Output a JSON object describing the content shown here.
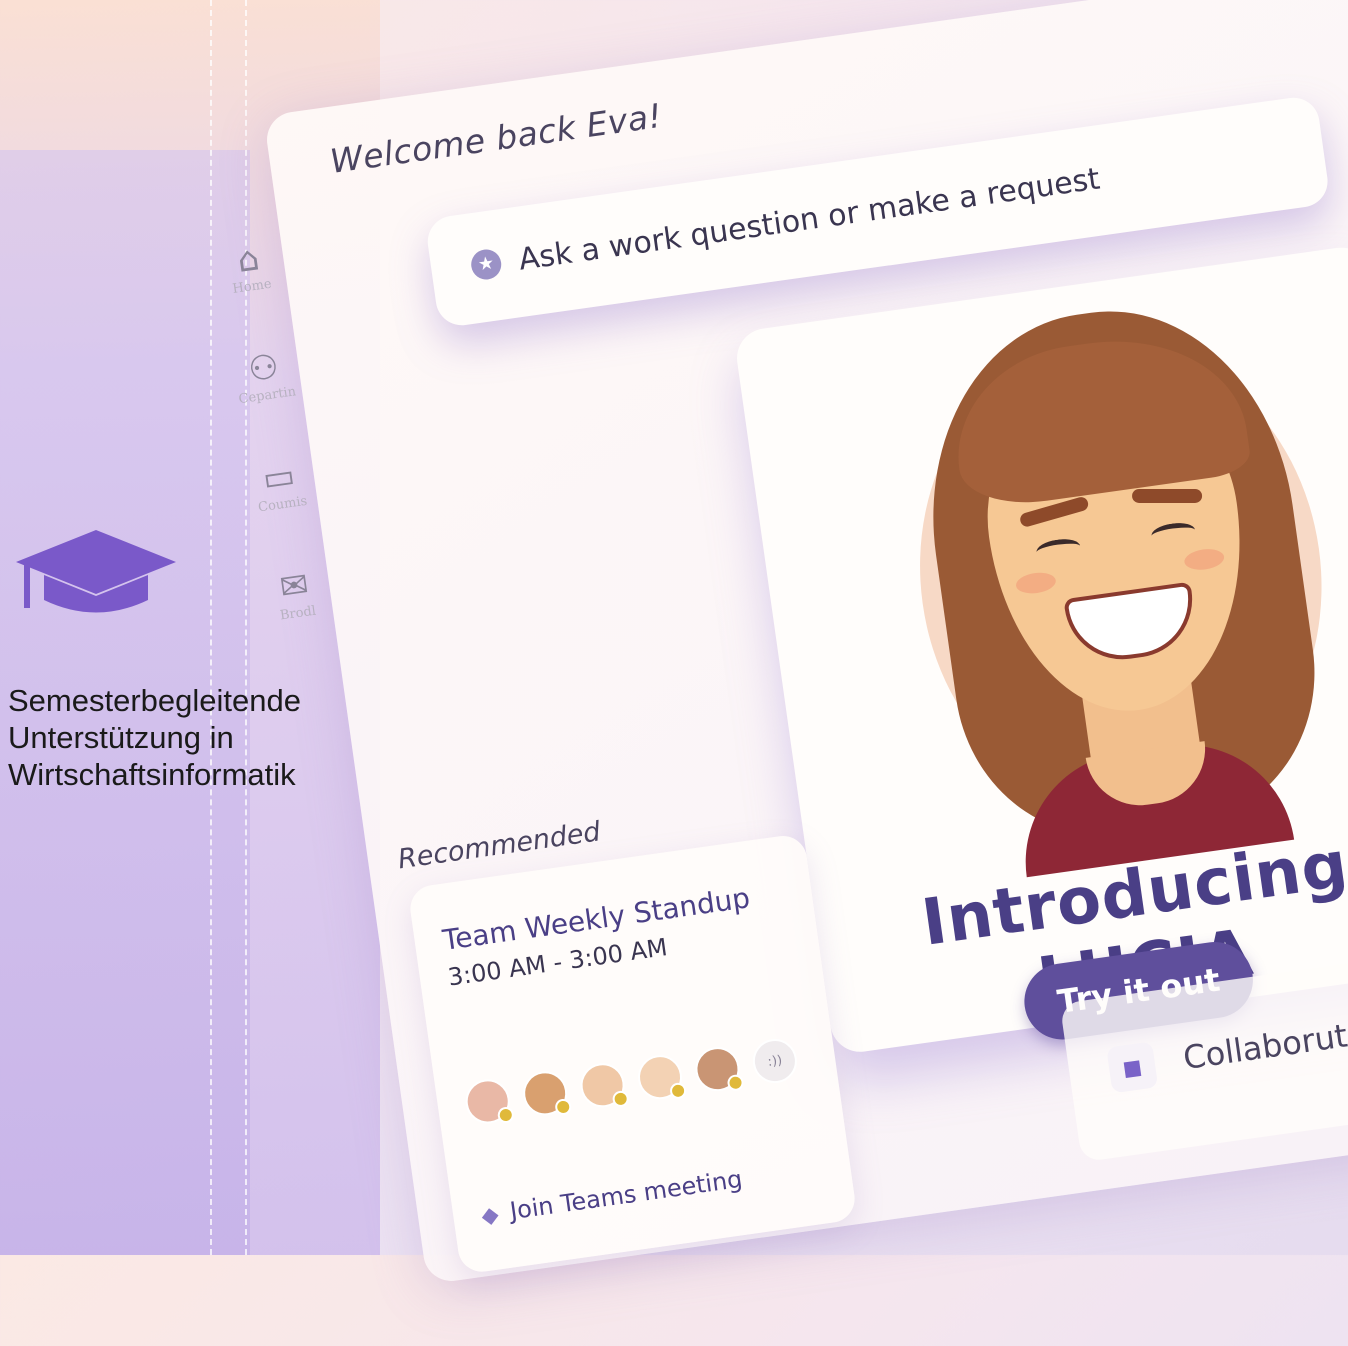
{
  "welcome": "Welcome back Eva!",
  "ask": {
    "placeholder": "Ask a work question or make a request",
    "icon": "star-icon"
  },
  "nav": [
    {
      "icon": "home-icon",
      "label": "Home"
    },
    {
      "icon": "people-icon",
      "label": "Cepartin"
    },
    {
      "icon": "book-icon",
      "label": "Coumis"
    },
    {
      "icon": "mail-icon",
      "label": "Brodl"
    }
  ],
  "promo": {
    "title": "Introducing LUCIA",
    "button": "Try it out"
  },
  "recommended": {
    "heading": "Recommended",
    "meeting": {
      "title": "Team Weekly Standup",
      "time": "3:00 AM - 3:00 AM",
      "more": ":))",
      "join": "Join Teams meeting"
    },
    "collab": "Collaborution Jo"
  },
  "brand": {
    "line1": "Semesterbegleitende",
    "line2": "Unterstützung in",
    "line3": "Wirtschaftsinformatik",
    "accent": "#7a59c9"
  }
}
